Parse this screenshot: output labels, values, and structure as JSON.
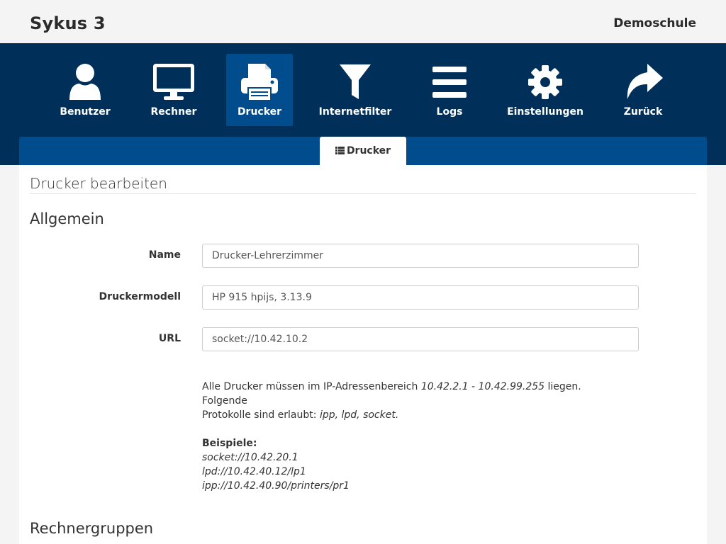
{
  "header": {
    "brand": "Sykus 3",
    "school": "Demoschule"
  },
  "nav": {
    "items": [
      {
        "label": "Benutzer",
        "icon": "user-icon"
      },
      {
        "label": "Rechner",
        "icon": "monitor-icon"
      },
      {
        "label": "Drucker",
        "icon": "printer-icon",
        "active": true
      },
      {
        "label": "Internetfilter",
        "icon": "filter-icon"
      },
      {
        "label": "Logs",
        "icon": "list-bars-icon"
      },
      {
        "label": "Einstellungen",
        "icon": "gear-icon"
      },
      {
        "label": "Zurück",
        "icon": "share-arrow-icon"
      }
    ]
  },
  "subnav": {
    "tab_label": "Drucker",
    "tab_icon": "th-list-icon"
  },
  "panel": {
    "title": "Drucker bearbeiten",
    "section_general": "Allgemein",
    "section_groups": "Rechnergruppen"
  },
  "form": {
    "name_label": "Name",
    "name_value": "Drucker-Lehrerzimmer",
    "model_label": "Druckermodell",
    "model_value": "HP 915 hpijs, 3.13.9",
    "url_label": "URL",
    "url_value": "socket://10.42.10.2"
  },
  "help": {
    "line1_pre": "Alle Drucker müssen im IP-Adressenbereich ",
    "range": "10.42.2.1 - 10.42.99.255",
    "line1_post": " liegen. Folgende",
    "line2_pre": "Protokolle sind erlaubt: ",
    "protocols": "ipp, lpd, socket.",
    "examples_title": "Beispiele:",
    "example1": "socket://10.42.20.1",
    "example2": "lpd://10.42.40.12/lp1",
    "example3": "ipp://10.42.40.90/printers/pr1"
  },
  "colors": {
    "nav_bg": "#00305a",
    "nav_active": "#004c8c",
    "subnav_bg": "#004c8c",
    "page_bg": "#f4f4f4"
  }
}
